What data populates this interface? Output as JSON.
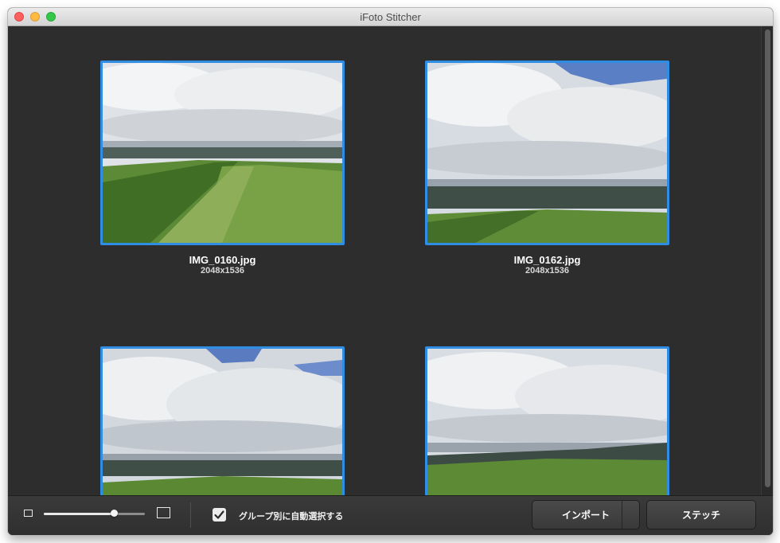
{
  "window": {
    "title": "iFoto Stitcher"
  },
  "photos": [
    {
      "name": "IMG_0160.jpg",
      "size": "2048x1536"
    },
    {
      "name": "IMG_0162.jpg",
      "size": "2048x1536"
    },
    {
      "name": "",
      "size": ""
    },
    {
      "name": "",
      "size": ""
    }
  ],
  "toolbar": {
    "zoom_level": 0.7,
    "auto_group_select_label": "グループ別に自動選択する",
    "auto_group_select_checked": true,
    "import_label": "インポート",
    "stitch_label": "ステッチ"
  },
  "colors": {
    "selection": "#2f8de4",
    "background": "#2d2d2d"
  }
}
